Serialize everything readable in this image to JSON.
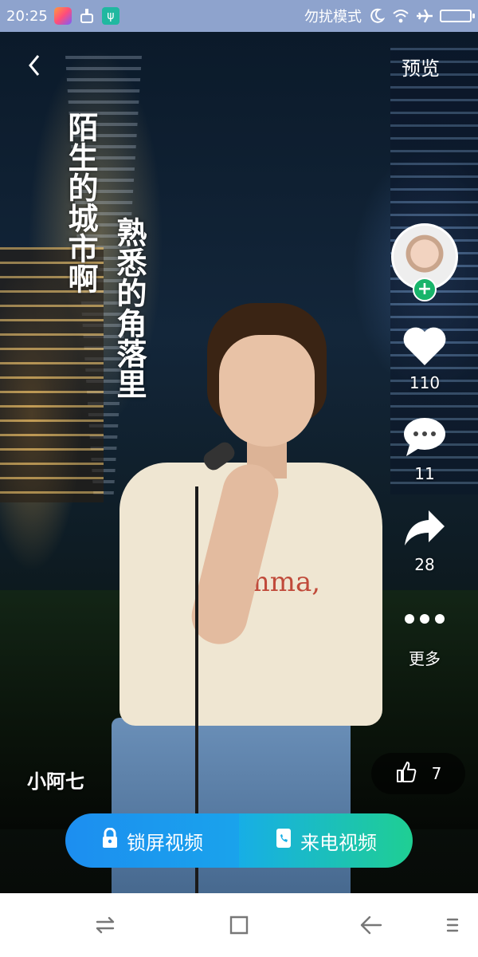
{
  "status_bar": {
    "time": "20:25",
    "dnd_label": "勿扰模式",
    "icons": [
      "app-icon",
      "clean-icon",
      "usb-icon",
      "moon-icon",
      "wifi-icon",
      "airplane-icon",
      "battery-icon"
    ]
  },
  "header": {
    "back_icon": "chevron-left-icon",
    "preview_label": "预览"
  },
  "lyrics": {
    "line1": "陌生的城市啊",
    "line2": "熟悉的角落里"
  },
  "shirt_print": "Comma,",
  "rail": {
    "avatar_add_symbol": "+",
    "likes": "110",
    "comments": "11",
    "shares": "28",
    "more_label": "更多"
  },
  "author": {
    "username": "小阿七"
  },
  "like_pill": {
    "icon": "thumbs-up-icon",
    "count": "7"
  },
  "actions": {
    "lockscreen_label": "锁屏视频",
    "callvideo_label": "来电视频"
  },
  "nav": {
    "icons": [
      "switch-icon",
      "home-square-icon",
      "back-arrow-icon",
      "menu-icon"
    ]
  },
  "colors": {
    "status_bar_bg": "#8ea3cd",
    "lock_button_bg": "#1c8ef0",
    "call_button_bg": "#1fcf93",
    "follow_plus_bg": "#18b46a"
  }
}
